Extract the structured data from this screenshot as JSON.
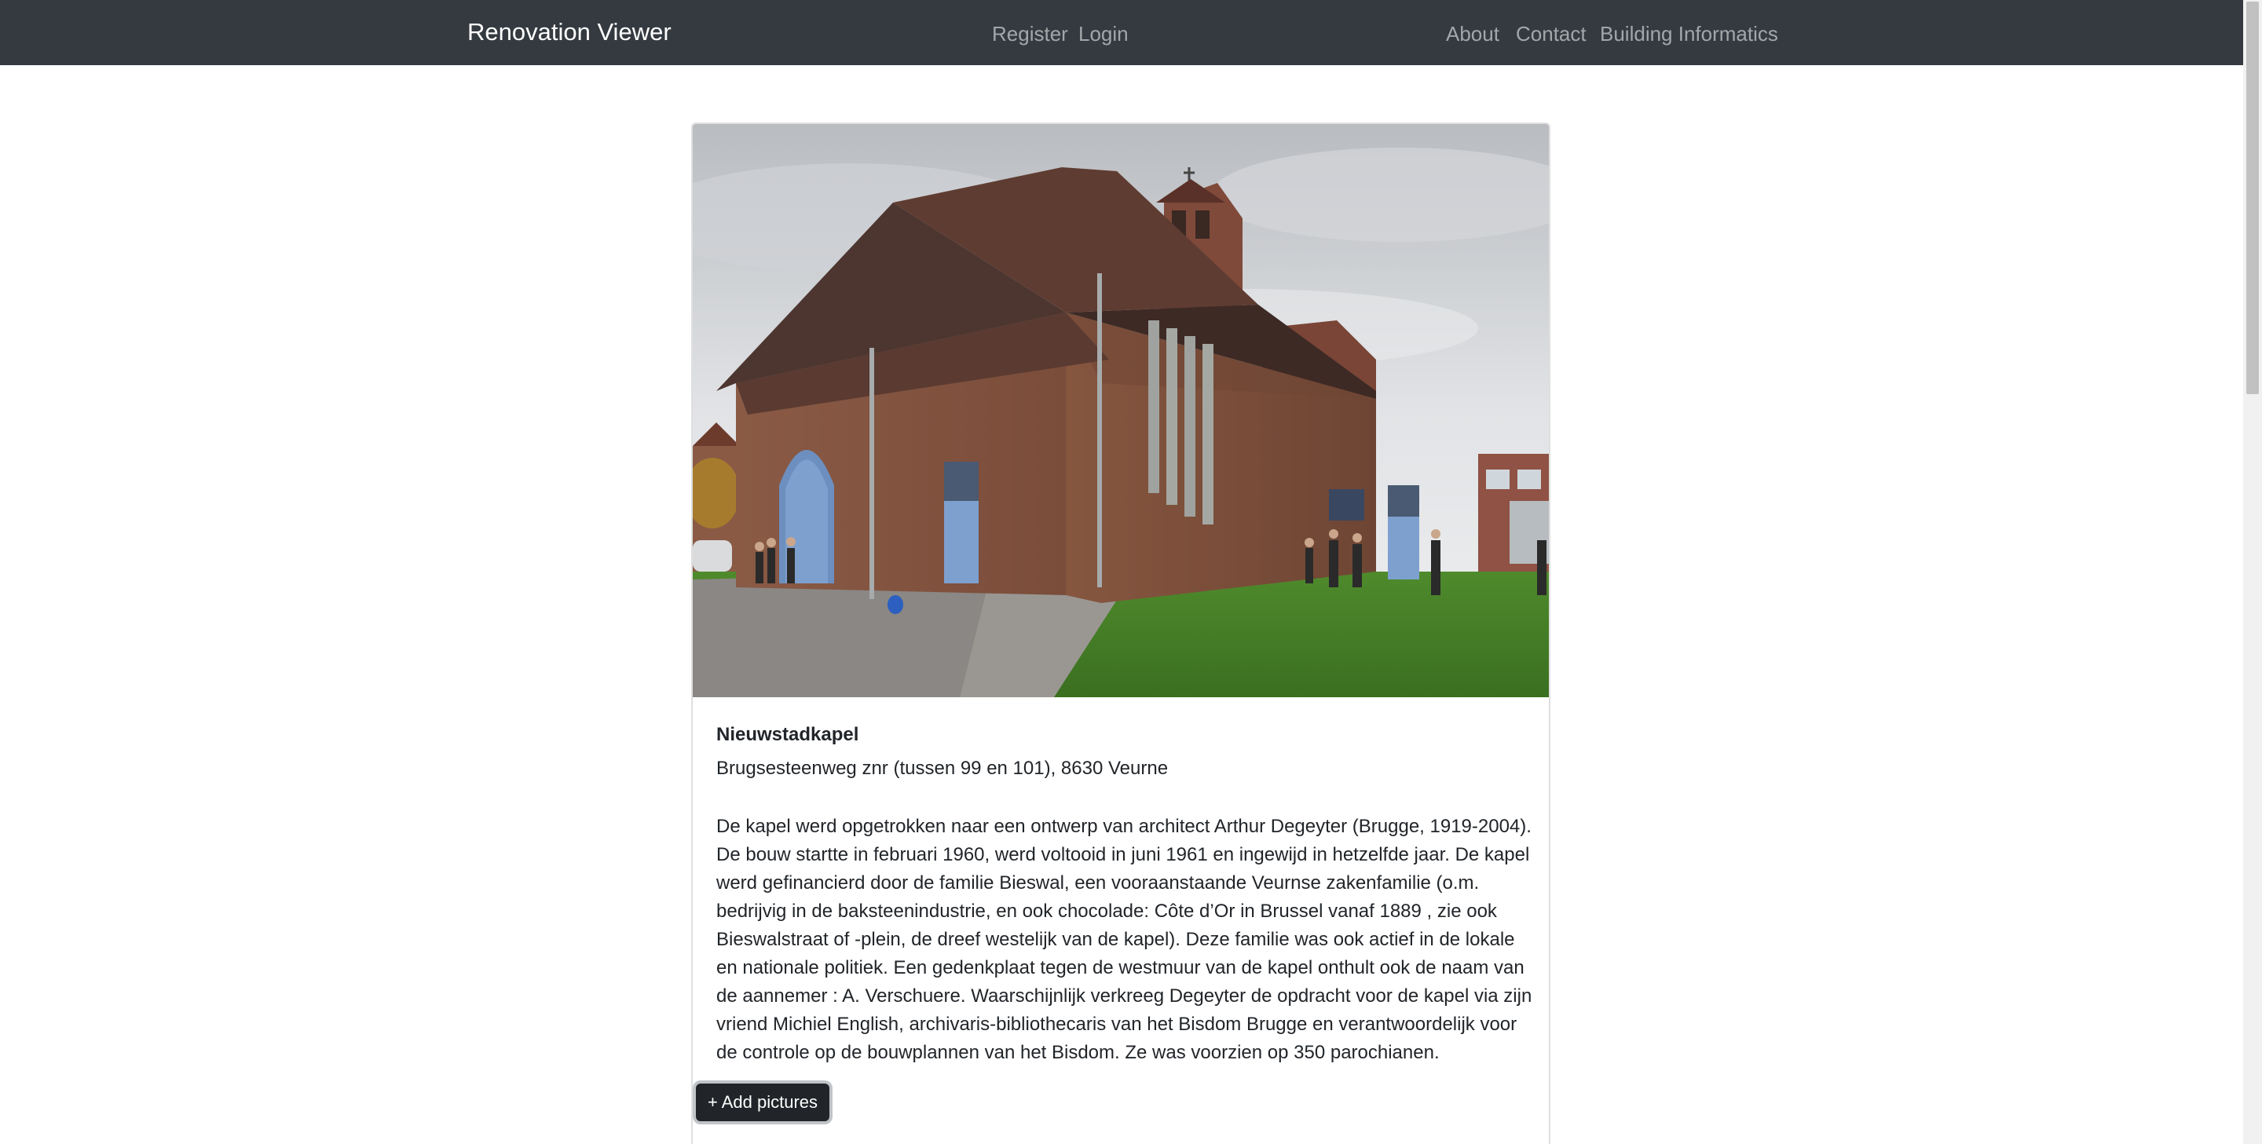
{
  "navbar": {
    "brand": "Renovation Viewer",
    "auth_links": [
      {
        "label": "Register"
      },
      {
        "label": "Login"
      }
    ],
    "right_links": [
      {
        "label": "About"
      },
      {
        "label": "Contact"
      },
      {
        "label": "Building Informatics"
      }
    ],
    "background_color": "#343a40"
  },
  "building": {
    "name": "Nieuwstadkapel",
    "address": "Brugsesteenweg znr (tussen 99 en 101), 8630 Veurne",
    "description": "De kapel werd opgetrokken naar een ontwerp van architect Arthur Degeyter (Brugge, 1919-2004). De bouw startte in februari 1960, werd voltooid in juni 1961 en ingewijd in hetzelfde jaar. De kapel werd gefinancierd door de familie Bieswal, een vooraanstaande Veurnse zakenfamilie (o.m. bedrijvig in de baksteenindustrie, en ook chocolade: Côte d’Or in Brussel vanaf 1889 , zie ook Bieswalstraat of -plein, de dreef westelijk van de kapel). Deze familie was ook actief in de lokale en nationale politiek. Een gedenkplaat tegen de westmuur van de kapel onthult ook de naam van de aannemer : A. Verschuere. Waarschijnlijk verkreeg Degeyter de opdracht voor de kapel via zijn vriend Michiel English, archivaris-bibliothecaris van het Bisdom Brugge en verantwoordelijk voor de controle op de bouwplannen van het Bisdom. Ze was voorzien op 350 parochianen.",
    "add_pictures_label": "+ Add pictures"
  }
}
